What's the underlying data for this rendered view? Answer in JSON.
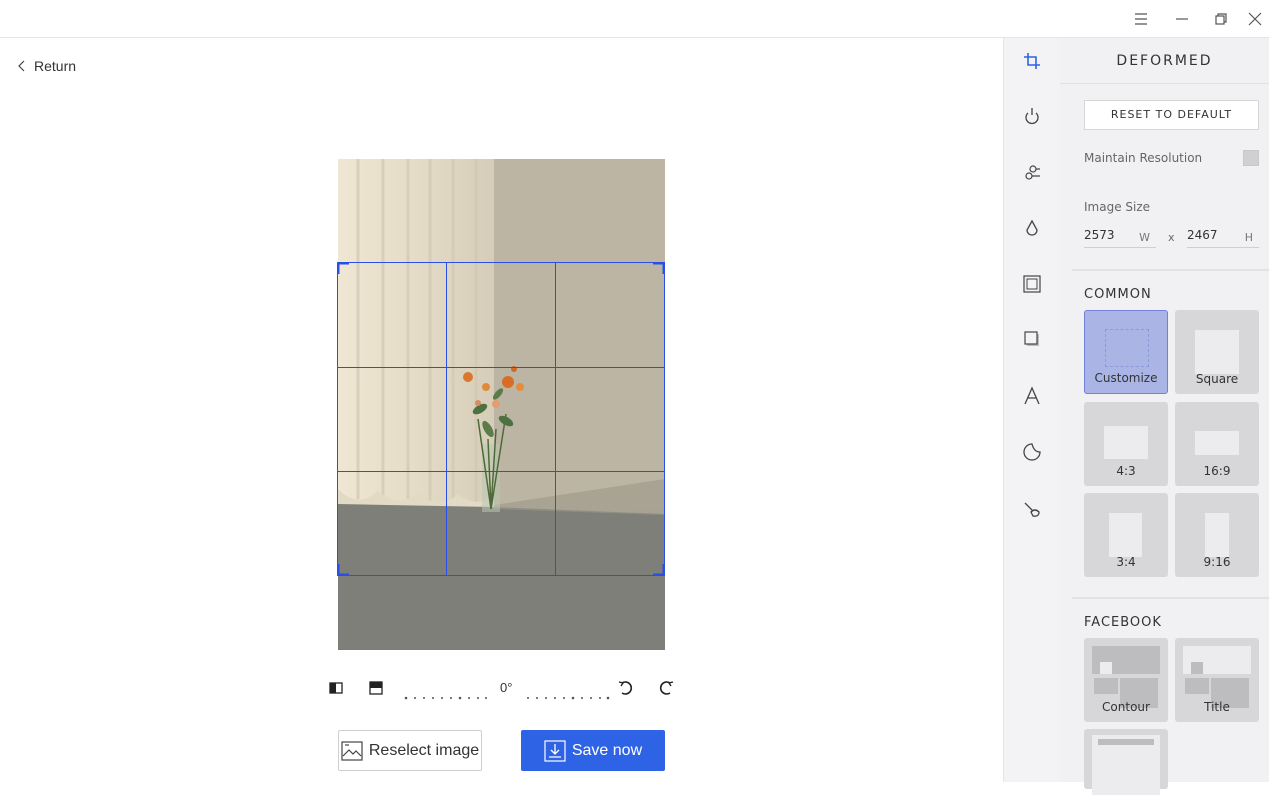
{
  "window": {
    "menu_icon": "hamburger-icon",
    "minimize_icon": "minimize-icon",
    "restore_icon": "restore-icon",
    "close_icon": "close-icon"
  },
  "main": {
    "return_label": "Return",
    "rotation_value": "0°",
    "reselect_label": "Reselect image",
    "save_label": "Save now"
  },
  "sidebar_icons": [
    "crop-icon",
    "bulb-icon",
    "adjust-icon",
    "drop-icon",
    "frame-icon",
    "shadow-icon",
    "text-icon",
    "sticker-icon",
    "brush-icon"
  ],
  "panel": {
    "title": "DEFORMED",
    "reset_label": "RESET TO DEFAULT",
    "maintain_resolution_label": "Maintain Resolution",
    "image_size_label": "Image Size",
    "width_value": "2573",
    "width_unit": "W",
    "times_label": "x",
    "height_value": "2467",
    "height_unit": "H",
    "common_title": "COMMON",
    "common_tiles": [
      "Customize",
      "Square",
      "4:3",
      "16:9",
      "3:4",
      "9:16"
    ],
    "facebook_title": "FACEBOOK",
    "facebook_tiles": [
      "Contour",
      "Title"
    ]
  },
  "colors": {
    "accent": "#2f63e6",
    "crop_line": "#2a4ee8",
    "selected_tile": "#aab5e6"
  }
}
